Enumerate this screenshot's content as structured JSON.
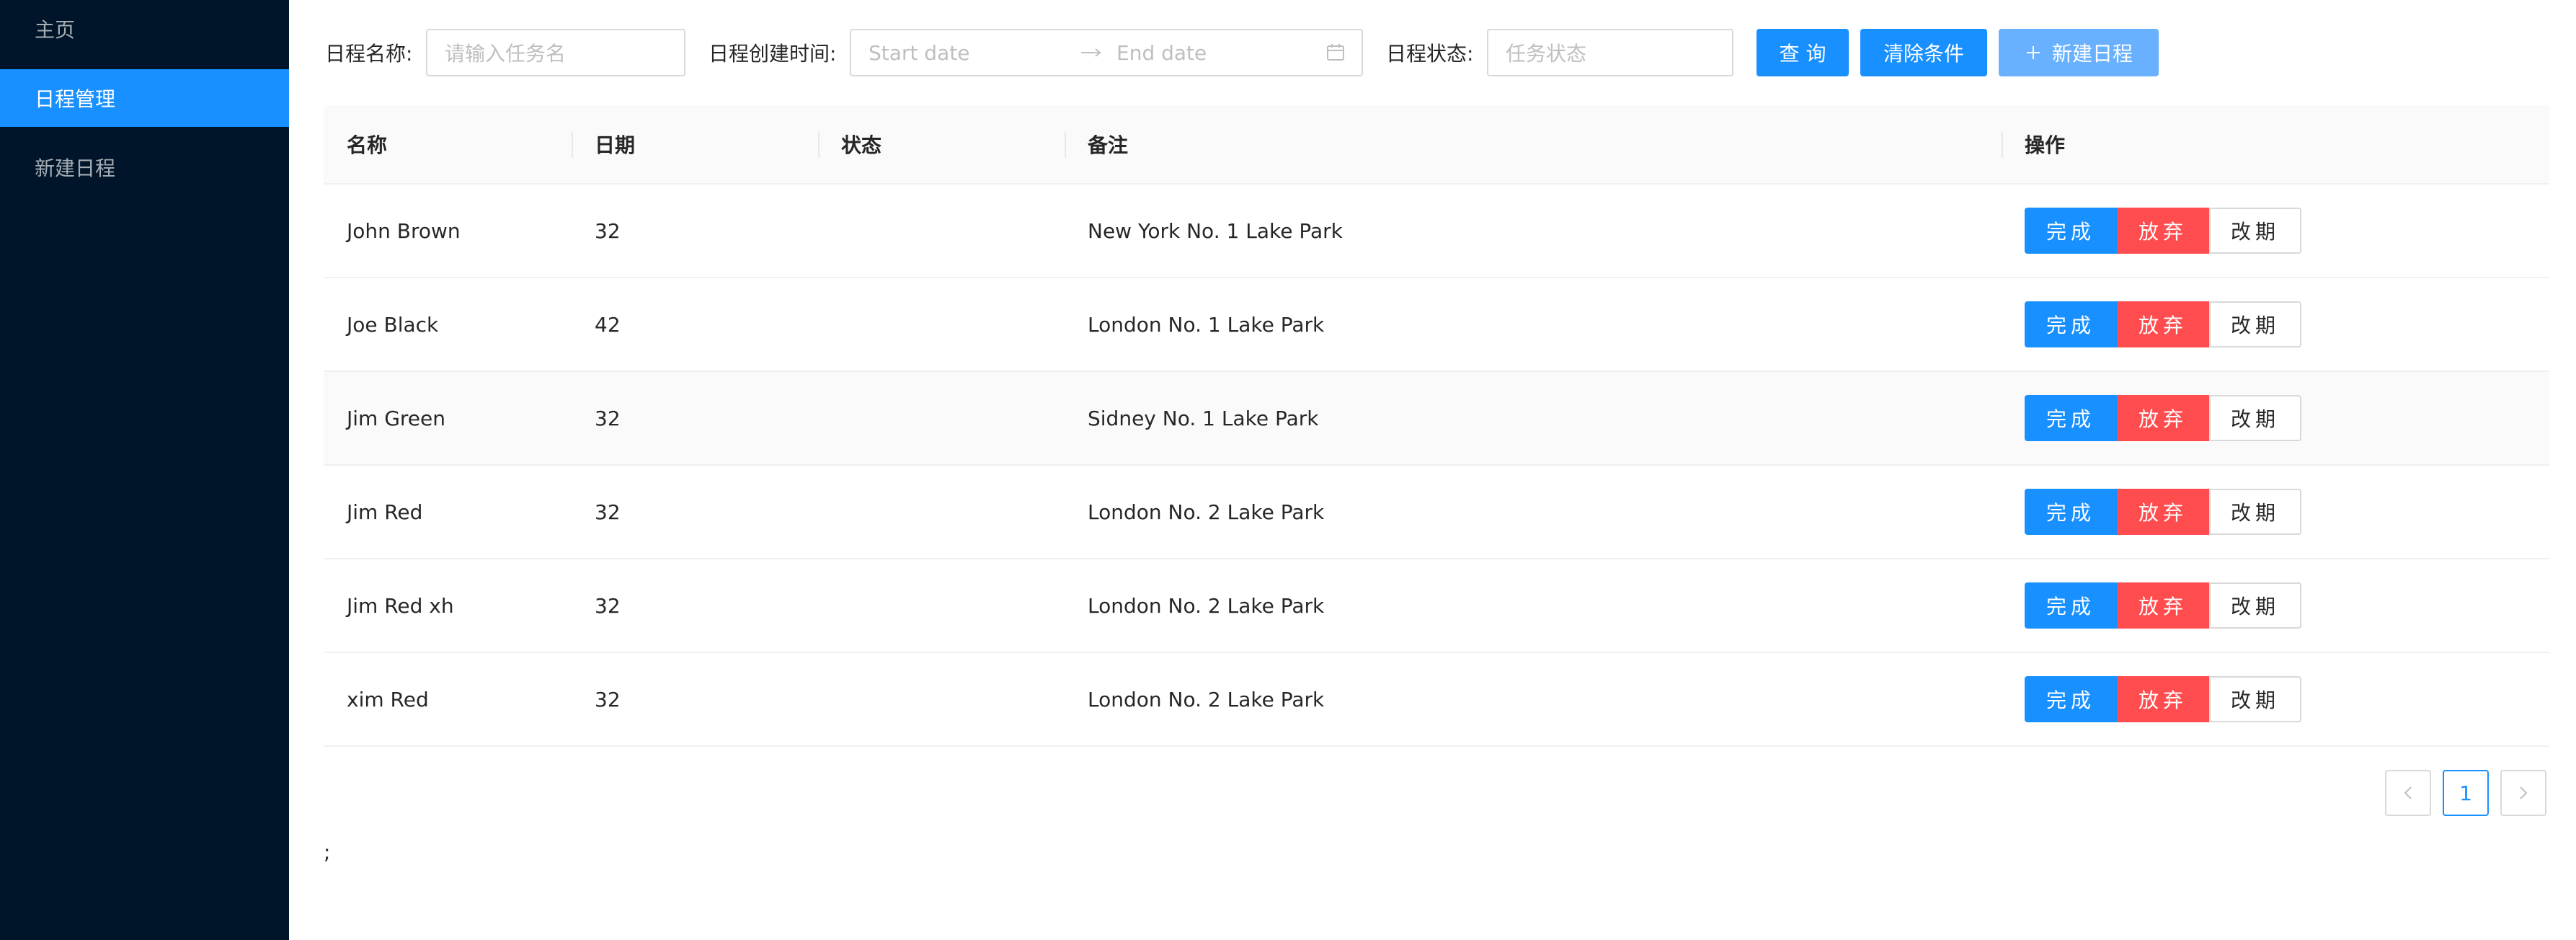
{
  "sidebar": {
    "items": [
      {
        "label": "主页"
      },
      {
        "label": "日程管理"
      },
      {
        "label": "新建日程"
      }
    ]
  },
  "filters": {
    "name_label": "日程名称:",
    "name_placeholder": "请输入任务名",
    "created_label": "日程创建时间:",
    "start_placeholder": "Start date",
    "end_placeholder": "End date",
    "status_label": "日程状态:",
    "status_placeholder": "任务状态",
    "query_label": "查 询",
    "clear_label": "清除条件",
    "new_label": "新建日程"
  },
  "table": {
    "columns": [
      "名称",
      "日期",
      "状态",
      "备注",
      "操作"
    ],
    "rows": [
      {
        "name": "John Brown",
        "date": "32",
        "status": "",
        "note": "New York No. 1 Lake Park"
      },
      {
        "name": "Joe Black",
        "date": "42",
        "status": "",
        "note": "London No. 1 Lake Park"
      },
      {
        "name": "Jim Green",
        "date": "32",
        "status": "",
        "note": "Sidney No. 1 Lake Park"
      },
      {
        "name": "Jim Red",
        "date": "32",
        "status": "",
        "note": "London No. 2 Lake Park"
      },
      {
        "name": "Jim Red xh",
        "date": "32",
        "status": "",
        "note": "London No. 2 Lake Park"
      },
      {
        "name": "xim Red",
        "date": "32",
        "status": "",
        "note": "London No. 2 Lake Park"
      }
    ],
    "actions": {
      "done": "完成",
      "abandon": "放弃",
      "delay": "改期"
    }
  },
  "pagination": {
    "current": "1"
  },
  "stray_text": ";",
  "colors": {
    "sidebar": "#001529",
    "primary": "#1890ff",
    "danger": "#ff4d4f"
  }
}
